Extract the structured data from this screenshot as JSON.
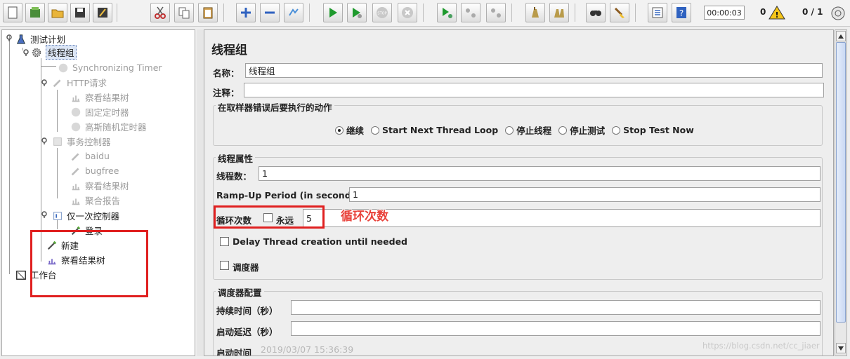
{
  "toolbar": {
    "buttons": [
      {
        "icon": "new-icon"
      },
      {
        "icon": "templates-icon"
      },
      {
        "icon": "open-icon"
      },
      {
        "icon": "save-icon"
      },
      {
        "icon": "save-as-icon"
      },
      {
        "icon": "cut-icon"
      },
      {
        "icon": "copy-icon"
      },
      {
        "icon": "paste-icon"
      },
      {
        "icon": "expand-icon"
      },
      {
        "icon": "collapse-icon"
      },
      {
        "icon": "toggle-icon"
      },
      {
        "icon": "start-icon"
      },
      {
        "icon": "start-no-pause-icon"
      },
      {
        "icon": "stop-icon"
      },
      {
        "icon": "shutdown-icon"
      },
      {
        "icon": "remote-start-icon"
      },
      {
        "icon": "remote-stop-icon"
      },
      {
        "icon": "remote-exit-icon"
      },
      {
        "icon": "clear-icon"
      },
      {
        "icon": "clear-all-icon"
      },
      {
        "icon": "search-icon"
      },
      {
        "icon": "reset-search-icon"
      },
      {
        "icon": "function-helper-icon"
      },
      {
        "icon": "help-icon"
      }
    ],
    "elapsed_time": "00:00:03",
    "error_count": "0",
    "threads": "0 / 1"
  },
  "tree": {
    "test_plan": "测试计划",
    "thread_group": "线程组",
    "sync_timer": "Synchronizing Timer",
    "http_request": "HTTP请求",
    "view_results_tree_1": "察看结果树",
    "constant_timer": "固定定时器",
    "gaussian_timer": "高斯随机定时器",
    "transaction_controller": "事务控制器",
    "baidu": "baidu",
    "bugfree": "bugfree",
    "view_results_tree_2": "察看结果树",
    "aggregate_report": "聚合报告",
    "once_only_controller": "仅一次控制器",
    "login": "登录",
    "new": "新建",
    "view_results_tree_3": "察看结果树",
    "workbench": "工作台"
  },
  "panel": {
    "title": "线程组",
    "name_label": "名称：",
    "name_value": "线程组",
    "comment_label": "注释：",
    "comment_value": "",
    "sampler_error_group": "在取样器错误后要执行的动作",
    "actions": [
      {
        "label": "继续",
        "selected": true
      },
      {
        "label": "Start Next Thread Loop",
        "selected": false
      },
      {
        "label": "停止线程",
        "selected": false
      },
      {
        "label": "停止测试",
        "selected": false
      },
      {
        "label": "Stop Test Now",
        "selected": false
      }
    ],
    "thread_props_group": "线程属性",
    "num_threads_label": "线程数：",
    "num_threads_value": "1",
    "rampup_label": "Ramp-Up Period (in seconds):",
    "rampup_value": "1",
    "loop_label": "循环次数",
    "forever_label": "永远",
    "forever_checked": false,
    "loop_value": "5",
    "annotation": "循环次数",
    "delay_label": "Delay Thread creation until needed",
    "delay_checked": false,
    "scheduler_label": "调度器",
    "scheduler_checked": false,
    "scheduler_config_group": "调度器配置",
    "duration_label": "持续时间（秒）",
    "duration_value": "",
    "startup_delay_label": "启动延迟（秒）",
    "startup_delay_value": "",
    "start_time_label": "启动时间",
    "start_time_value": "2019/03/07 15:36:39"
  },
  "watermark": "https://blog.csdn.net/cc_jiaer",
  "colors": {
    "accent_red": "#e02020",
    "annotation_red": "#e8413a",
    "selection": "#dbe5f5"
  }
}
